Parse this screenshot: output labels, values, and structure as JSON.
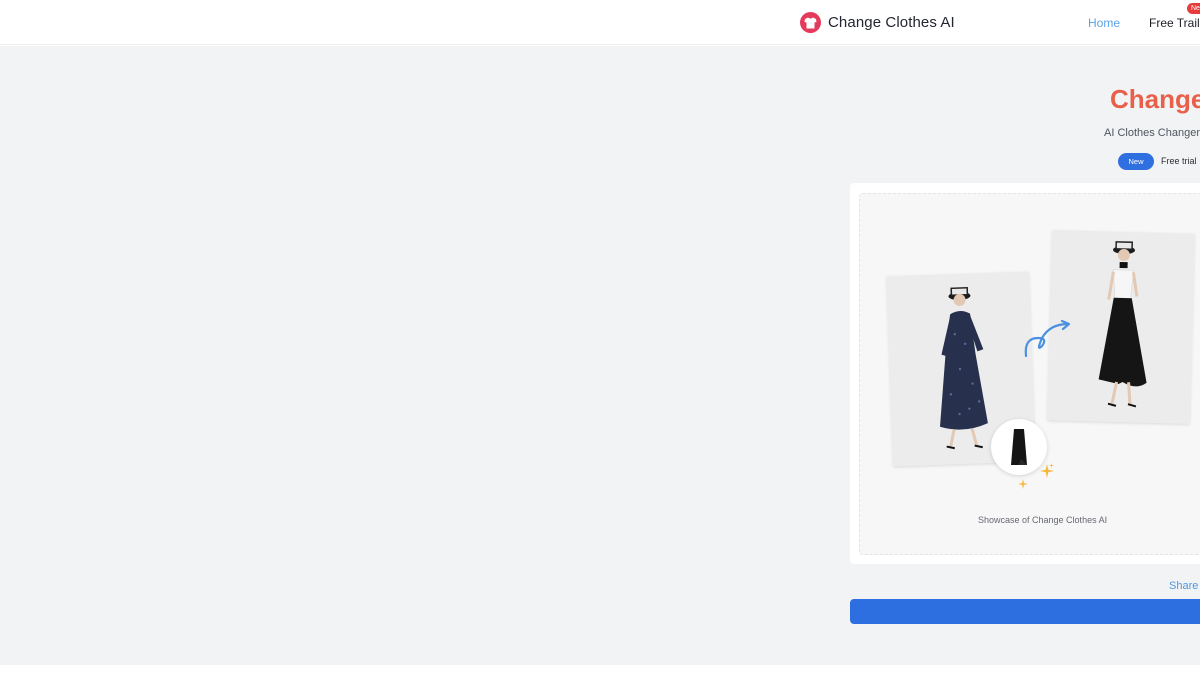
{
  "header": {
    "brand_name": "Change Clothes AI",
    "logo_icon": "tshirt-icon",
    "nav": {
      "home": "Home",
      "free_trial": "Free Trail",
      "badge": "New"
    }
  },
  "hero": {
    "title": "Change",
    "subtitle": "AI Clothes Changer,",
    "new_pill": "New",
    "trial_text": "Free trial"
  },
  "showcase": {
    "caption": "Showcase of Change Clothes AI",
    "arrow_icon": "curved-arrow-icon",
    "sparkle_icon": "sparkle-icon"
  },
  "share": {
    "label": "Share a"
  },
  "colors": {
    "accent": "#e9604a",
    "brand_logo": "#e43a5b",
    "primary_blue": "#2d6fe0",
    "link_blue": "#5aa3e8",
    "badge_red": "#e53b3b",
    "page_bg": "#f2f3f5"
  }
}
